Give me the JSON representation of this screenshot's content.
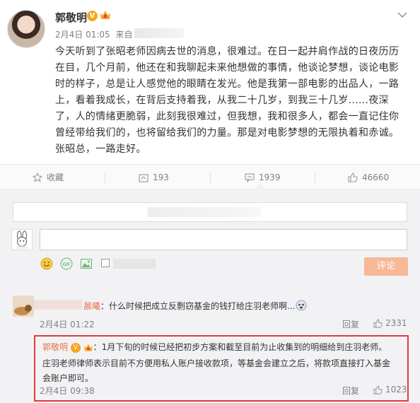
{
  "post": {
    "author": "郭敬明",
    "verified_badge": "V",
    "date": "2月4日 01:05",
    "source_prefix": "来自 iF",
    "body": "今天听到了张昭老师因病去世的消息，很难过。在日一起并肩作战的日夜历历在目，几个月前，他还在和我聊起未来他想做的事情，他谈论梦想，谈论电影时的样子，总是让人感觉他的眼睛在发光。他是我第一部电影的出品人，一路上，看着我成长，在背后支持着我，从我二十几岁，到我三十几岁......夜深了，人的情绪更脆弱，此刻我很难过，但我想，我和很多人，都会一直记住你曾经带给我们的，也将留给我们的力量。那是对电影梦想的无限执着和赤诚。张昭总，一路走好。"
  },
  "actions": {
    "favorite_label": "收藏",
    "repost_count": "193",
    "comment_count": "1939",
    "like_count": "46660"
  },
  "composer": {
    "submit_label": "评论"
  },
  "comments": [
    {
      "name_suffix": "晨曦",
      "text": "：什么时候把成立反剽窃基金的钱打给庄羽老师啊...",
      "time": "2月4日 01:22",
      "reply_label": "回复",
      "likes": "2331"
    }
  ],
  "reply": {
    "name": "郭敬明",
    "badge": "V",
    "line1": "：1月下旬的时候已经把初步方案和截至目前为止收集到的明细给到庄羽老师。",
    "line2": "庄羽老师律师表示目前不方便用私人账户接收款项，等基金会建立之后，将款项直接打入基金",
    "line3": "会账户即可。",
    "time": "2月4日 09:38",
    "reply_label": "回复",
    "likes": "1023"
  },
  "colors": {
    "accent_orange": "#eb7350",
    "badge_gold": "#f5a623",
    "highlight_red": "#e13a3a",
    "button_disabled": "#f7b898"
  }
}
